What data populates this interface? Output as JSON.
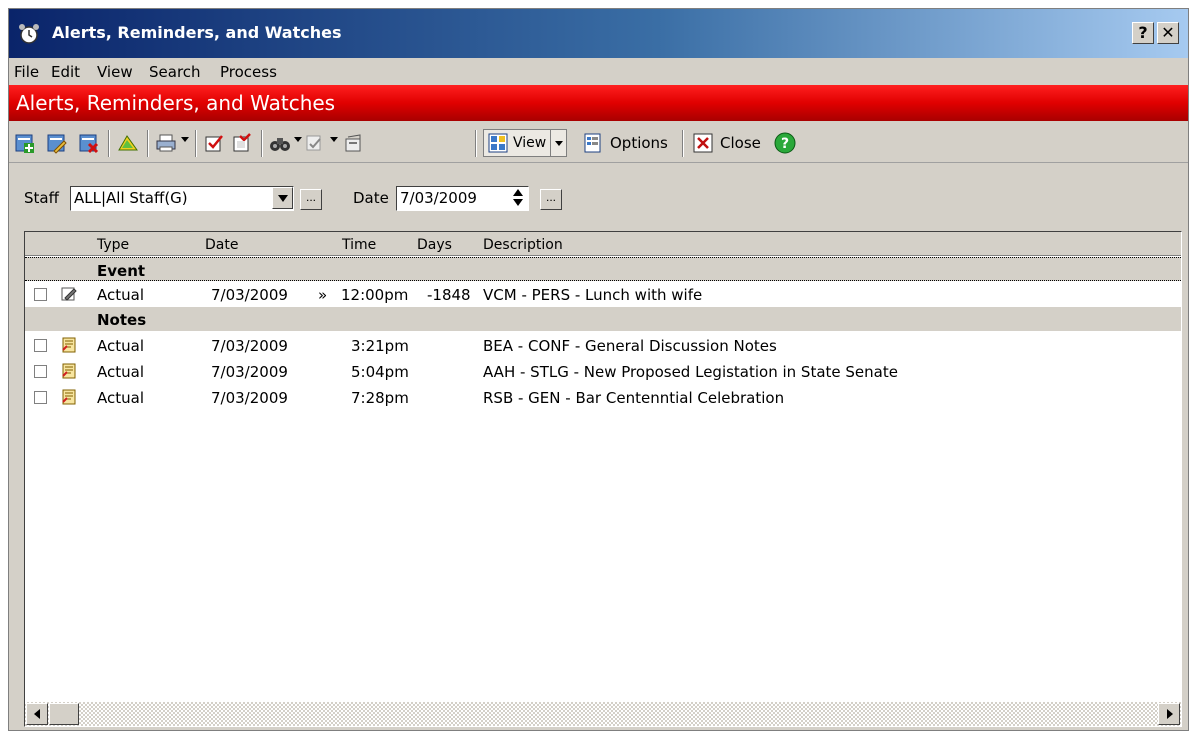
{
  "window": {
    "title": "Alerts, Reminders, and Watches",
    "help_label": "?",
    "close_label": "✕"
  },
  "menu": [
    "File",
    "Edit",
    "View",
    "Search",
    "Process"
  ],
  "banner": {
    "title": "Alerts, Reminders, and Watches",
    "color": "#e00000"
  },
  "toolbar": {
    "view_label": "View",
    "options_label": "Options",
    "close_label": "Close",
    "icons": [
      "add-icon",
      "edit-icon",
      "delete-icon",
      "highlight-icon",
      "print-icon",
      "check-icon",
      "uncheck-icon",
      "find-icon",
      "process-icon",
      "properties-icon",
      "view-icon",
      "options-icon",
      "close-icon",
      "help-icon"
    ]
  },
  "filter": {
    "staff_label": "Staff",
    "staff_value": "ALL|All Staff(G)",
    "date_label": "Date",
    "date_value": "7/03/2009",
    "ellipsis": "..."
  },
  "list": {
    "columns": [
      "Type",
      "Date",
      "Time",
      "Days",
      "Description"
    ],
    "groups": [
      {
        "name": "Event",
        "rows": [
          {
            "type": "Actual",
            "date": "7/03/2009",
            "marker": "»",
            "time": "12:00pm",
            "days": "-1848",
            "description": "VCM  - PERS - Lunch with wife",
            "icon": "event-icon"
          }
        ]
      },
      {
        "name": "Notes",
        "rows": [
          {
            "type": "Actual",
            "date": "7/03/2009",
            "marker": "",
            "time": "3:21pm",
            "days": "",
            "description": "BEA  - CONF - General Discussion Notes",
            "icon": "note-icon"
          },
          {
            "type": "Actual",
            "date": "7/03/2009",
            "marker": "",
            "time": "5:04pm",
            "days": "",
            "description": "AAH  - STLG - New Proposed Legistation in State Senate",
            "icon": "note-icon"
          },
          {
            "type": "Actual",
            "date": "7/03/2009",
            "marker": "",
            "time": "7:28pm",
            "days": "",
            "description": "RSB  - GEN - Bar Centenntial Celebration",
            "icon": "note-icon"
          }
        ]
      }
    ]
  }
}
